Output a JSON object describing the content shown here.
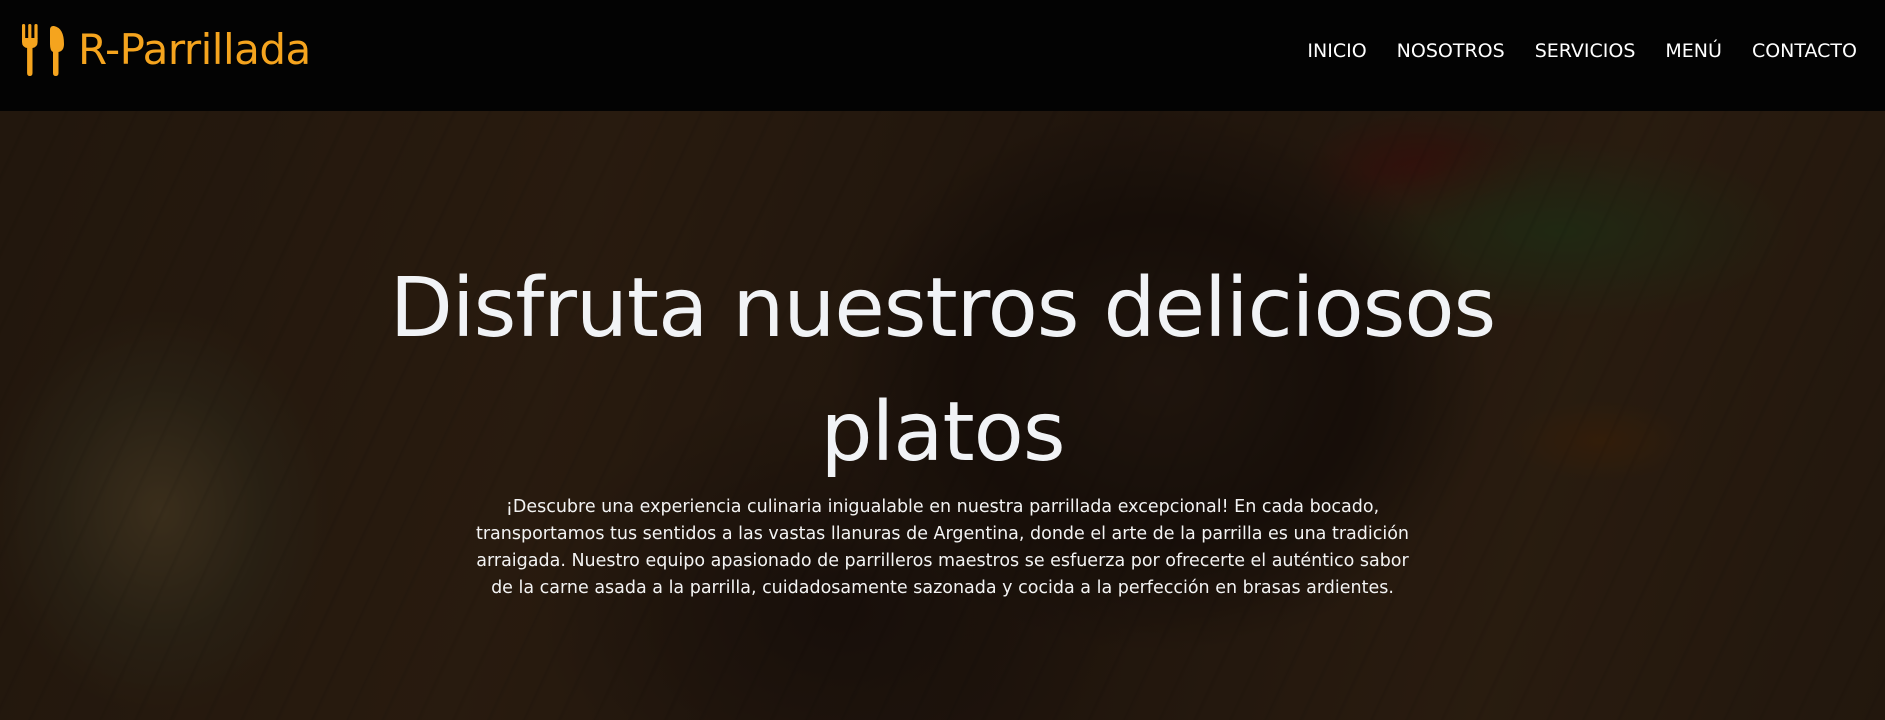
{
  "brand": {
    "name": "R-Parrillada",
    "icon": "utensils-icon",
    "color": "#f5a41e"
  },
  "nav": {
    "items": [
      {
        "label": "INICIO"
      },
      {
        "label": "NOSOTROS"
      },
      {
        "label": "SERVICIOS"
      },
      {
        "label": "MENÚ"
      },
      {
        "label": "CONTACTO"
      }
    ]
  },
  "hero": {
    "title": "Disfruta nuestros deliciosos platos",
    "description": "¡Descubre una experiencia culinaria inigualable en nuestra parrillada excepcional! En cada bocado, transportamos tus sentidos a las vastas llanuras de Argentina, donde el arte de la parrilla es una tradición arraigada. Nuestro equipo apasionado de parrilleros maestros se esfuerza por ofrecerte el auténtico sabor de la carne asada a la parrilla, cuidadosamente sazonada y cocida a la perfección en brasas ardientes."
  }
}
